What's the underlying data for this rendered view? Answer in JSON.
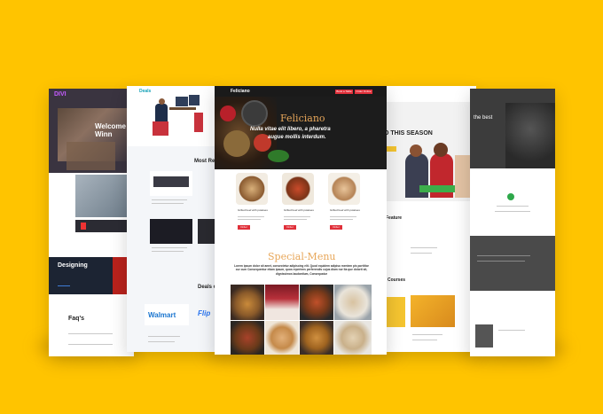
{
  "background_color": "#FFC400",
  "divi": {
    "logo": "DIVI",
    "hero_heading": "Welcome Winn",
    "section_heading": "Designing",
    "faq_heading": "Faq's"
  },
  "deals": {
    "logo": "Deals",
    "most_heading": "Most Re",
    "deals_heading": "Deals o",
    "walmart": "Walmart",
    "flipkart": "Flip"
  },
  "feliciano": {
    "logo": "Feliciano",
    "hero_title": "Feliciano",
    "hero_line1": "Nulla vitae elit libero, a pharetra",
    "hero_line2": "augue mollis interdum.",
    "nav_buttons": [
      "Book a Table",
      "Order Online"
    ],
    "dish_names": [
      "Grilled beef with potatoes",
      "Grilled beef with potatoes",
      "Grilled beef with potatoes"
    ],
    "order_label": "Order Now",
    "special_title": "Special-Menu",
    "special_text": "Lorem ipsum dolor sit amet, consectetur adipiscing elit. Quod equidem adipiso mentem pis porttitor cur cum Consequentur etiam ipsum, quos repertens perferendis cujus diam nor Ita que dolorit sit, dignissimos laudantium, Consequatur"
  },
  "school": {
    "hero_heading": "O THIS SEASON",
    "feature_heading": "Feature",
    "courses_heading": "Courses"
  },
  "dark": {
    "heading": "the best"
  }
}
